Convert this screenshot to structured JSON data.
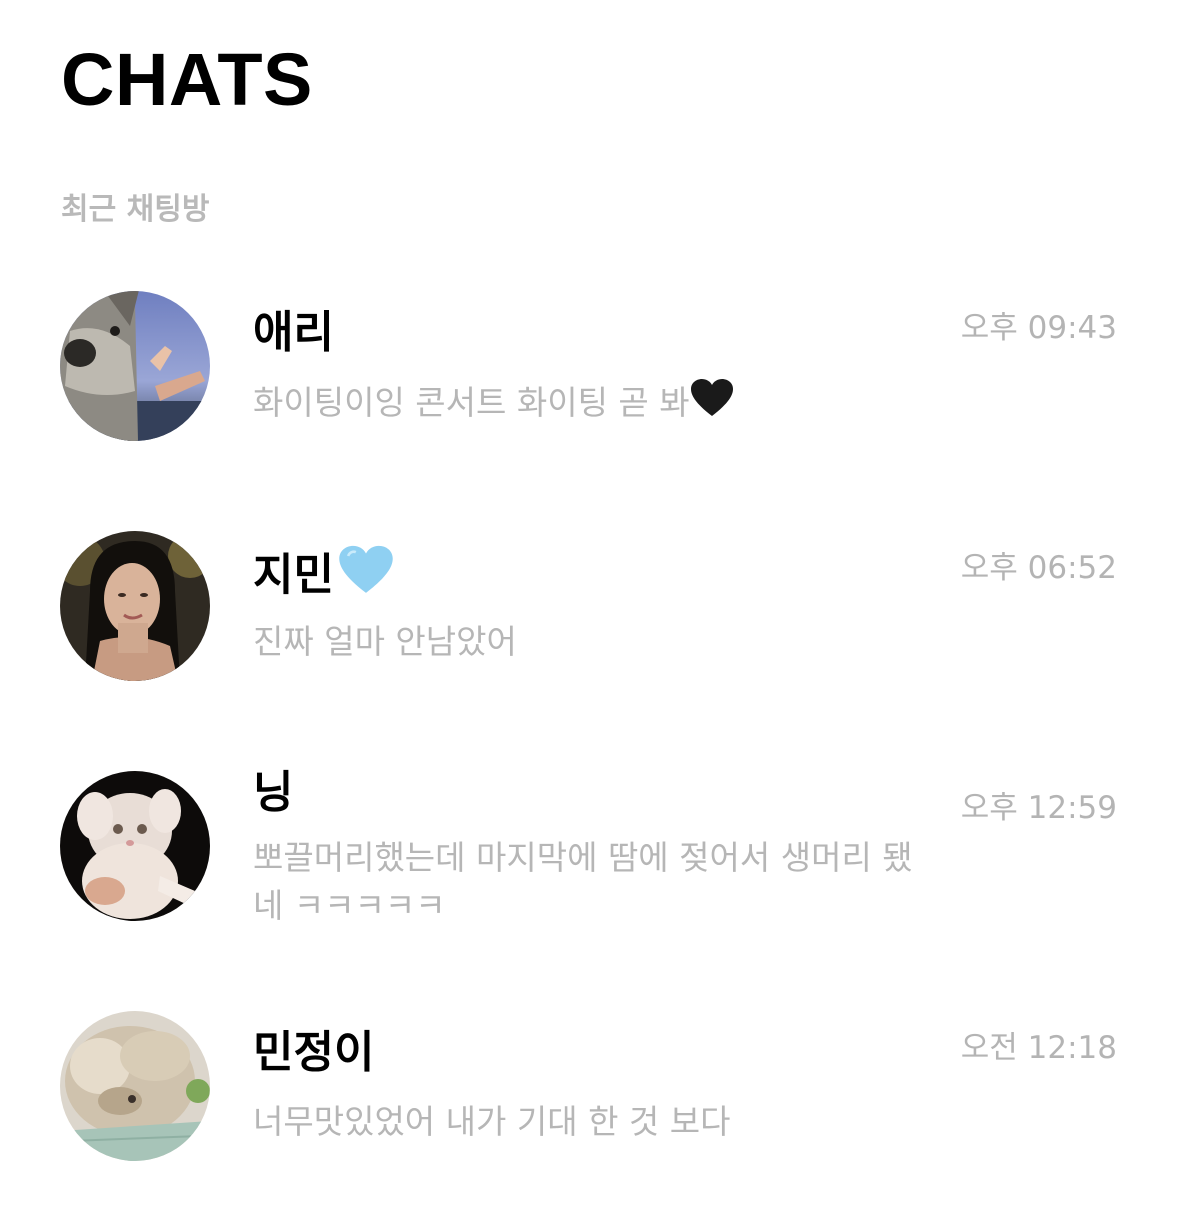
{
  "header": {
    "title": "CHATS",
    "section_label": "최근 채팅방"
  },
  "chats": [
    {
      "name": "애리",
      "name_emoji": "",
      "time": "오후 09:43",
      "preview": "화이팅이잉 콘서트 화이팅 곧 봐",
      "preview_emoji": "black-heart-icon",
      "avatar": "dog-beach-photo"
    },
    {
      "name": "지민",
      "name_emoji": "light-blue-heart-icon",
      "time": "오후 06:52",
      "preview": "진짜 얼마 안남았어",
      "preview_emoji": "",
      "avatar": "woman-portrait-photo"
    },
    {
      "name": "닝",
      "name_emoji": "",
      "time": "오후 12:59",
      "preview": "뽀끌머리했는데 마지막에 땀에 젖어서 생머리 됐네 ㅋㅋㅋㅋㅋ",
      "preview_emoji": "",
      "avatar": "fluffy-cat-photo"
    },
    {
      "name": "민정이",
      "name_emoji": "",
      "time": "오전 12:18",
      "preview": "너무맛있었어 내가 기대 한 것 보다",
      "preview_emoji": "",
      "avatar": "sleeping-puppy-photo"
    }
  ],
  "colors": {
    "black_heart": "#1a1a1a",
    "blue_heart": "#8fd0f2",
    "muted_text": "#b6b6b6"
  }
}
